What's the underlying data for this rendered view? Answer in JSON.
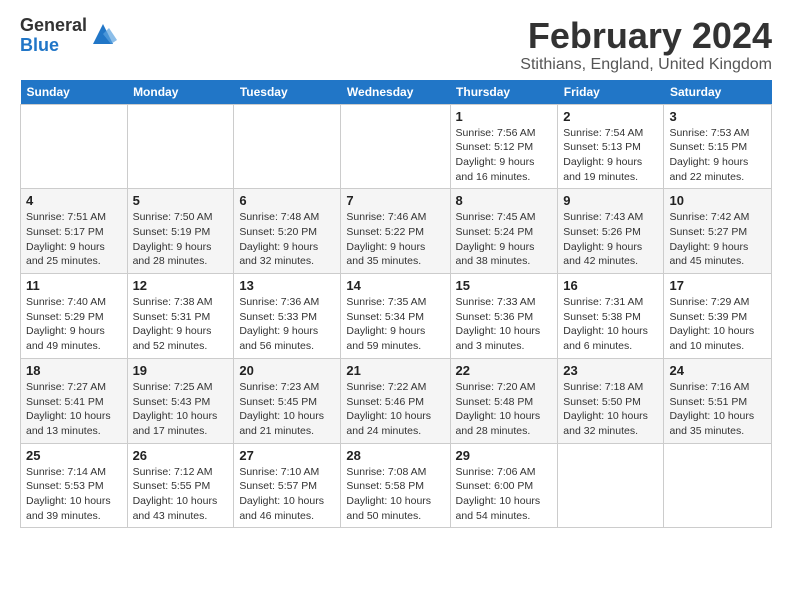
{
  "logo": {
    "general": "General",
    "blue": "Blue"
  },
  "header": {
    "month": "February 2024",
    "location": "Stithians, England, United Kingdom"
  },
  "days_of_week": [
    "Sunday",
    "Monday",
    "Tuesday",
    "Wednesday",
    "Thursday",
    "Friday",
    "Saturday"
  ],
  "weeks": [
    [
      {
        "day": "",
        "info": ""
      },
      {
        "day": "",
        "info": ""
      },
      {
        "day": "",
        "info": ""
      },
      {
        "day": "",
        "info": ""
      },
      {
        "day": "1",
        "info": "Sunrise: 7:56 AM\nSunset: 5:12 PM\nDaylight: 9 hours\nand 16 minutes."
      },
      {
        "day": "2",
        "info": "Sunrise: 7:54 AM\nSunset: 5:13 PM\nDaylight: 9 hours\nand 19 minutes."
      },
      {
        "day": "3",
        "info": "Sunrise: 7:53 AM\nSunset: 5:15 PM\nDaylight: 9 hours\nand 22 minutes."
      }
    ],
    [
      {
        "day": "4",
        "info": "Sunrise: 7:51 AM\nSunset: 5:17 PM\nDaylight: 9 hours\nand 25 minutes."
      },
      {
        "day": "5",
        "info": "Sunrise: 7:50 AM\nSunset: 5:19 PM\nDaylight: 9 hours\nand 28 minutes."
      },
      {
        "day": "6",
        "info": "Sunrise: 7:48 AM\nSunset: 5:20 PM\nDaylight: 9 hours\nand 32 minutes."
      },
      {
        "day": "7",
        "info": "Sunrise: 7:46 AM\nSunset: 5:22 PM\nDaylight: 9 hours\nand 35 minutes."
      },
      {
        "day": "8",
        "info": "Sunrise: 7:45 AM\nSunset: 5:24 PM\nDaylight: 9 hours\nand 38 minutes."
      },
      {
        "day": "9",
        "info": "Sunrise: 7:43 AM\nSunset: 5:26 PM\nDaylight: 9 hours\nand 42 minutes."
      },
      {
        "day": "10",
        "info": "Sunrise: 7:42 AM\nSunset: 5:27 PM\nDaylight: 9 hours\nand 45 minutes."
      }
    ],
    [
      {
        "day": "11",
        "info": "Sunrise: 7:40 AM\nSunset: 5:29 PM\nDaylight: 9 hours\nand 49 minutes."
      },
      {
        "day": "12",
        "info": "Sunrise: 7:38 AM\nSunset: 5:31 PM\nDaylight: 9 hours\nand 52 minutes."
      },
      {
        "day": "13",
        "info": "Sunrise: 7:36 AM\nSunset: 5:33 PM\nDaylight: 9 hours\nand 56 minutes."
      },
      {
        "day": "14",
        "info": "Sunrise: 7:35 AM\nSunset: 5:34 PM\nDaylight: 9 hours\nand 59 minutes."
      },
      {
        "day": "15",
        "info": "Sunrise: 7:33 AM\nSunset: 5:36 PM\nDaylight: 10 hours\nand 3 minutes."
      },
      {
        "day": "16",
        "info": "Sunrise: 7:31 AM\nSunset: 5:38 PM\nDaylight: 10 hours\nand 6 minutes."
      },
      {
        "day": "17",
        "info": "Sunrise: 7:29 AM\nSunset: 5:39 PM\nDaylight: 10 hours\nand 10 minutes."
      }
    ],
    [
      {
        "day": "18",
        "info": "Sunrise: 7:27 AM\nSunset: 5:41 PM\nDaylight: 10 hours\nand 13 minutes."
      },
      {
        "day": "19",
        "info": "Sunrise: 7:25 AM\nSunset: 5:43 PM\nDaylight: 10 hours\nand 17 minutes."
      },
      {
        "day": "20",
        "info": "Sunrise: 7:23 AM\nSunset: 5:45 PM\nDaylight: 10 hours\nand 21 minutes."
      },
      {
        "day": "21",
        "info": "Sunrise: 7:22 AM\nSunset: 5:46 PM\nDaylight: 10 hours\nand 24 minutes."
      },
      {
        "day": "22",
        "info": "Sunrise: 7:20 AM\nSunset: 5:48 PM\nDaylight: 10 hours\nand 28 minutes."
      },
      {
        "day": "23",
        "info": "Sunrise: 7:18 AM\nSunset: 5:50 PM\nDaylight: 10 hours\nand 32 minutes."
      },
      {
        "day": "24",
        "info": "Sunrise: 7:16 AM\nSunset: 5:51 PM\nDaylight: 10 hours\nand 35 minutes."
      }
    ],
    [
      {
        "day": "25",
        "info": "Sunrise: 7:14 AM\nSunset: 5:53 PM\nDaylight: 10 hours\nand 39 minutes."
      },
      {
        "day": "26",
        "info": "Sunrise: 7:12 AM\nSunset: 5:55 PM\nDaylight: 10 hours\nand 43 minutes."
      },
      {
        "day": "27",
        "info": "Sunrise: 7:10 AM\nSunset: 5:57 PM\nDaylight: 10 hours\nand 46 minutes."
      },
      {
        "day": "28",
        "info": "Sunrise: 7:08 AM\nSunset: 5:58 PM\nDaylight: 10 hours\nand 50 minutes."
      },
      {
        "day": "29",
        "info": "Sunrise: 7:06 AM\nSunset: 6:00 PM\nDaylight: 10 hours\nand 54 minutes."
      },
      {
        "day": "",
        "info": ""
      },
      {
        "day": "",
        "info": ""
      }
    ]
  ]
}
